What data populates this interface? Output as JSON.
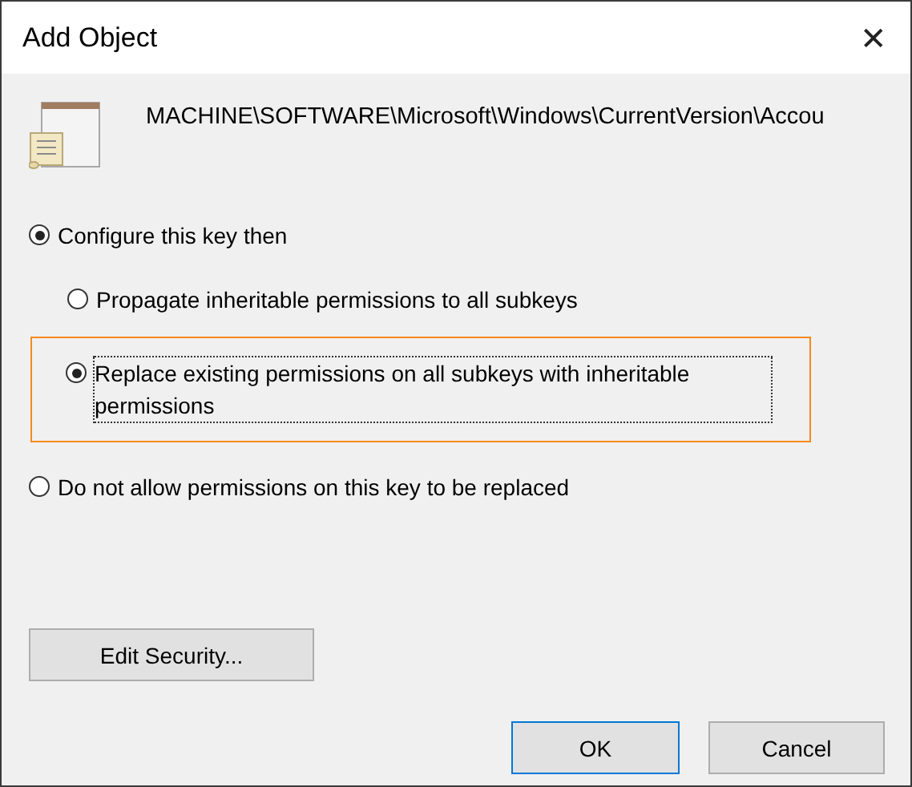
{
  "window": {
    "title": "Add Object",
    "close": "✕"
  },
  "object_path": "MACHINE\\SOFTWARE\\Microsoft\\Windows\\CurrentVersion\\Accou",
  "options": [
    {
      "label": "Configure this key then",
      "selected": true,
      "children": [
        {
          "label": "Propagate inheritable permissions to all subkeys",
          "selected": false,
          "highlighted": false,
          "focused": false
        },
        {
          "label": "Replace existing permissions on all subkeys with inheritable permissions",
          "selected": true,
          "highlighted": true,
          "focused": true
        }
      ]
    },
    {
      "label": "Do not allow permissions on this key to be replaced",
      "selected": false
    }
  ],
  "edit_button": "Edit Security...",
  "buttons": [
    {
      "label": "OK",
      "default": true
    },
    {
      "label": "Cancel",
      "default": false
    }
  ]
}
